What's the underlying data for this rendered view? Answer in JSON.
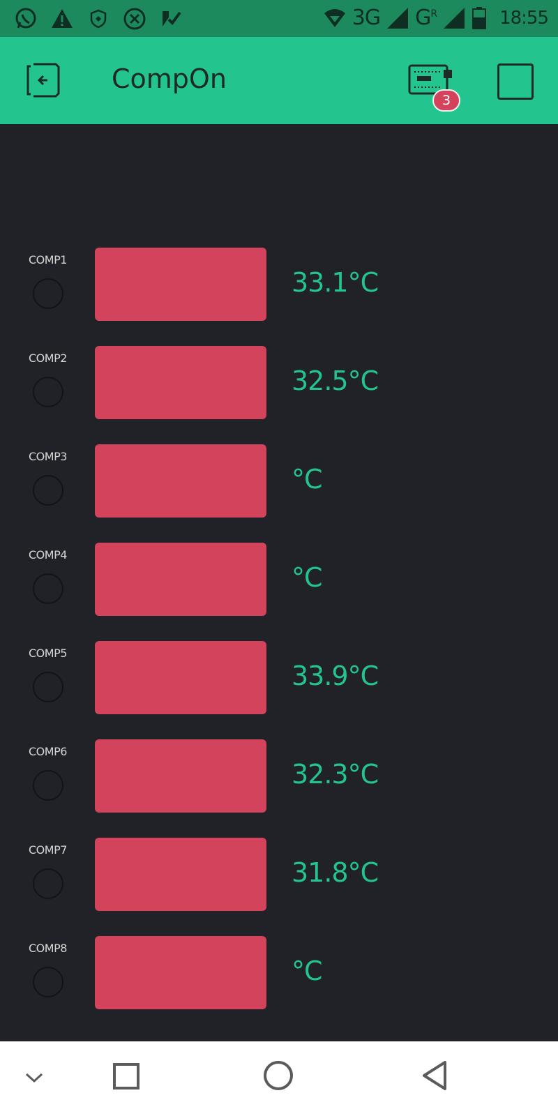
{
  "status_bar": {
    "network_label": "3G",
    "roaming_label": "G",
    "roaming_sup": "R",
    "time": "18:55"
  },
  "app_bar": {
    "title": "CompOn",
    "device_badge_count": "3"
  },
  "widgets": [
    {
      "label": "COMP1",
      "temp": "33.1°C"
    },
    {
      "label": "COMP2",
      "temp": "32.5°C"
    },
    {
      "label": "COMP3",
      "temp": "°C"
    },
    {
      "label": "COMP4",
      "temp": "°C"
    },
    {
      "label": "COMP5",
      "temp": "33.9°C"
    },
    {
      "label": "COMP6",
      "temp": "32.3°C"
    },
    {
      "label": "COMP7",
      "temp": "31.8°C"
    },
    {
      "label": "COMP8",
      "temp": "°C"
    }
  ],
  "colors": {
    "accent": "#23c48e",
    "button": "#d3435c",
    "background": "#212228"
  }
}
